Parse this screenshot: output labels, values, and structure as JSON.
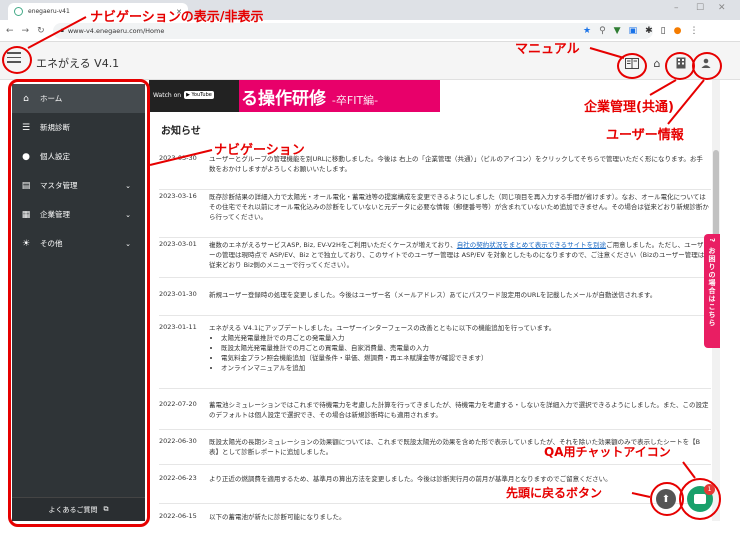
{
  "browser": {
    "tab_title": "enegaeru-v41",
    "url": "www-v4.enegaeru.com/Home"
  },
  "app": {
    "title": "エネがえる V4.1"
  },
  "sidebar": {
    "items": [
      {
        "label": "ホーム",
        "icon": "home-icon",
        "expandable": false
      },
      {
        "label": "新規診断",
        "icon": "list-icon",
        "expandable": false
      },
      {
        "label": "個人設定",
        "icon": "person-icon",
        "expandable": false
      },
      {
        "label": "マスタ管理",
        "icon": "database-icon",
        "expandable": true
      },
      {
        "label": "企業管理",
        "icon": "building-icon",
        "expandable": true
      },
      {
        "label": "その他",
        "icon": "sun-icon",
        "expandable": true
      }
    ],
    "faq_label": "よくあるご質問"
  },
  "video": {
    "watch_on": "Watch on",
    "youtube": "YouTube",
    "title": "る操作研修",
    "subtitle": "-卒FIT編-"
  },
  "news": {
    "heading": "お知らせ",
    "items": [
      {
        "date": "2023-03-30",
        "text": "ユーザーとグループの管理機能を別URLに移動しました。今後は 右上の「企業管理（共通）」（ビルのアイコン）をクリックしてそちらで管理いただく形になります。お手数をおかけしますがよろしくお願いいたします。"
      },
      {
        "date": "2023-03-16",
        "text": "既存診断結果の詳細入力で太陽光・オール電化・蓄電池等の提案構成を変更できるようにしました（同じ項目を再入力する手間が省けます）。なお、オール電化についてはその住宅でそれ以前にオール電化込みの診断をしていないと元データに必要な情報（郵便番号等）が含まれていないため追加できません。その場合は従来どおり新規診断から行ってください。"
      },
      {
        "date": "2023-03-01",
        "text_before": "複数のエネがえるサービスASP, Biz, EV-V2Hをご利用いただくケースが増えており、",
        "link": "自社の契約状況をまとめて表示できるサイトを別途",
        "text_after": "ご用意しました。ただし、ユーザーの管理は現時点で ASP/EV、Biz とで独立しており、このサイトでのユーザー管理は ASP/EV を対象としたものになりますので、ご注意ください（Bizのユーザー管理は従来どおり Biz側のメニューで行ってください）。"
      },
      {
        "date": "2023-01-30",
        "text": "新規ユーザー登録時の処理を変更しました。今後はユーザー名（メールアドレス）あてにパスワード設定用のURLを記載したメールが自動送信されます。"
      },
      {
        "date": "2023-01-11",
        "text": "エネがえる V4.1にアップデートしました。ユーザーインターフェースの改善とともに以下の機能追加を行っています。",
        "bullets": [
          "太陽光発電量推計での月ごとの発電量入力",
          "既設太陽光発電量推計での月ごとの買電量、自家消費量、売電量の入力",
          "電気料金プラン照会機能追加（従量条件・単価、燃調費・再エネ賦課金等が確認できます）",
          "オンラインマニュアルを追加"
        ]
      },
      {
        "date": "2022-07-20",
        "text": "蓄電池シミュレーションではこれまで待機電力を考慮した計算を行ってきましたが、待機電力を考慮する・しないを詳細入力で選択できるようにしました。また、この設定のデフォルトは個人設定で選択でき、その場合は新規診断時にも適用されます。"
      },
      {
        "date": "2022-06-30",
        "text": "既設太陽光の長期シミュレーションの効果額については、これまで既設太陽光の効果を含めた形で表示していましたが、それを除いた効果額のみで表示したシートを【B表】として診断レポートに追加しました。"
      },
      {
        "date": "2022-06-23",
        "text": "より正近の燃調費を適用するため、基準月の算出方法を変更しました。今後は診断実行月の前月が基準月となりますのでご留意ください。"
      },
      {
        "date": "2022-06-15",
        "text": "以下の蓄電池が新たに診断可能になりました。"
      }
    ]
  },
  "help_tab": "お困りの場合はこちら",
  "chat_badge": "1",
  "annotations": {
    "nav_toggle": "ナビゲーションの表示/非表示",
    "navigation": "ナビゲーション",
    "manual": "マニュアル",
    "company_admin": "企業管理(共通)",
    "user_info": "ユーザー情報",
    "qa_chat": "QA用チャットアイコン",
    "back_to_top": "先頭に戻るボタン"
  },
  "colors": {
    "annotation": "#e60000",
    "sidebar_bg": "#2f3437",
    "video_brand": "#e8006a",
    "chat": "#1aa06b",
    "help": "#e91e63"
  }
}
